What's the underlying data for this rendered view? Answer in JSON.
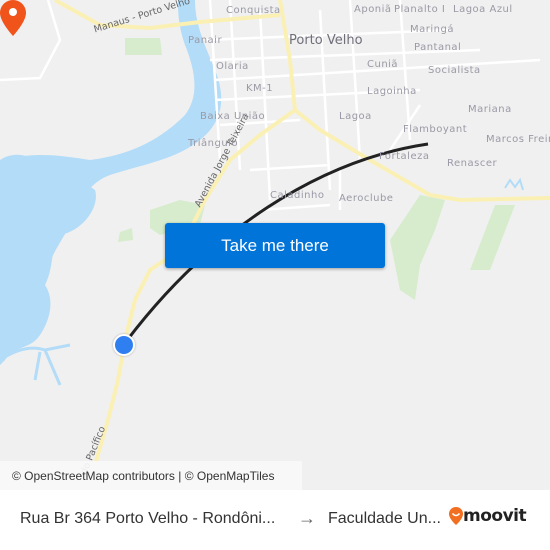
{
  "map": {
    "city_label": "Porto Velho",
    "neighborhoods": [
      "Conquista",
      "Aponiã",
      "Planalto I",
      "Lagoa Azul",
      "Maringá",
      "Panair",
      "Pantanal",
      "Olaria",
      "Cuniã",
      "Socialista",
      "KM-1",
      "Lagoinha",
      "Baixa União",
      "Lagoa",
      "Mariana",
      "Flamboyant",
      "Marcos Freire",
      "Triângulo",
      "Fortaleza",
      "Renascer",
      "Caladinho",
      "Aeroclube"
    ],
    "roads": [
      "Manaus - Porto Velho",
      "Avenida Jorge Teixeira",
      "do Pacífico"
    ],
    "colors": {
      "water": "#b3dcf8",
      "park": "#d6eccd",
      "major_road": "#fbf0b4",
      "minor_road": "#ffffff",
      "route_line": "#222222",
      "origin": "#2f7ff0",
      "destination": "#f0541a",
      "cta": "#0074d9"
    }
  },
  "cta": {
    "label": "Take me there"
  },
  "attribution": "© OpenStreetMap contributors | © OpenMapTiles",
  "footer": {
    "origin": "Rua Br 364 Porto Velho - Rondôni...",
    "arrow": "→",
    "destination": "Faculdade Un...",
    "brand": "moovit"
  }
}
